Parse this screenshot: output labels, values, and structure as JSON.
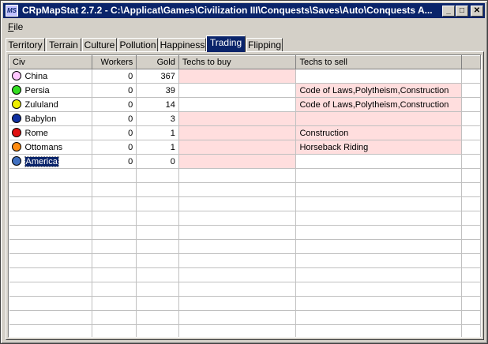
{
  "window": {
    "title": "CRpMapStat 2.7.2 - C:\\Applicat\\Games\\Civilization III\\Conquests\\Saves\\Auto\\Conquests A...",
    "icon_text": "MS",
    "minimize": "_",
    "maximize": "□",
    "close": "✕"
  },
  "menu": {
    "file_u": "F",
    "file_rest": "ile"
  },
  "tabs": [
    "Territory",
    "Terrain",
    "Culture",
    "Pollution",
    "Happiness",
    "Trading",
    "Flipping"
  ],
  "active_tab": "Trading",
  "table": {
    "headers": [
      "Civ",
      "Workers",
      "Gold",
      "Techs to buy",
      "Techs to sell"
    ],
    "rows": [
      {
        "civ": "China",
        "color": "#ffc8ff",
        "workers": "0",
        "gold": "367",
        "buy": "",
        "sell": "",
        "buy_pink": true,
        "sell_pink": false
      },
      {
        "civ": "Persia",
        "color": "#33dd22",
        "workers": "0",
        "gold": "39",
        "buy": "",
        "sell": "Code of Laws,Polytheism,Construction",
        "buy_pink": false,
        "sell_pink": true
      },
      {
        "civ": "Zululand",
        "color": "#eeee00",
        "workers": "0",
        "gold": "14",
        "buy": "",
        "sell": "Code of Laws,Polytheism,Construction",
        "buy_pink": false,
        "sell_pink": true
      },
      {
        "civ": "Babylon",
        "color": "#1030a0",
        "workers": "0",
        "gold": "3",
        "buy": "",
        "sell": "",
        "buy_pink": true,
        "sell_pink": true
      },
      {
        "civ": "Rome",
        "color": "#e01010",
        "workers": "0",
        "gold": "1",
        "buy": "",
        "sell": "Construction",
        "buy_pink": true,
        "sell_pink": true
      },
      {
        "civ": "Ottomans",
        "color": "#ff8c10",
        "workers": "0",
        "gold": "1",
        "buy": "",
        "sell": "Horseback Riding",
        "buy_pink": true,
        "sell_pink": true
      },
      {
        "civ": "America",
        "color": "#4070c0",
        "workers": "0",
        "gold": "0",
        "buy": "",
        "sell": "",
        "buy_pink": true,
        "sell_pink": false,
        "selected": true
      }
    ]
  }
}
